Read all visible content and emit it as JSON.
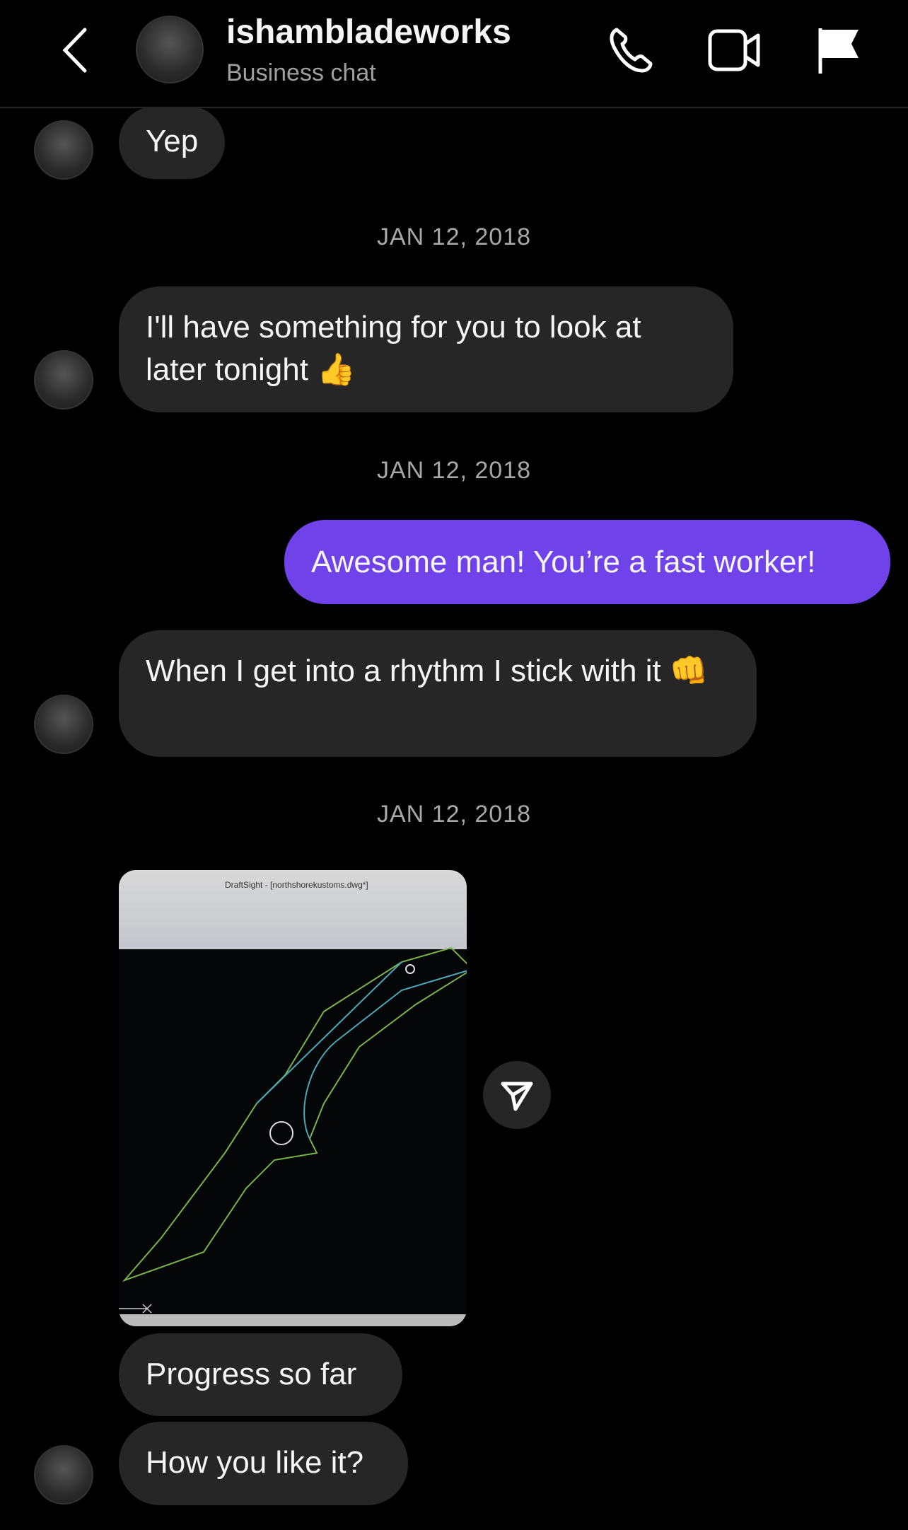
{
  "header": {
    "title": "ishambladeworks",
    "subtitle": "Business chat",
    "icons": [
      "back-chevron-icon",
      "phone-icon",
      "video-camera-icon",
      "flag-icon"
    ]
  },
  "messages": [
    {
      "from": "them",
      "text": "Yep"
    },
    {
      "date": "JAN 12, 2018"
    },
    {
      "from": "them",
      "text": "I'll have something for you to look at later tonight 👍"
    },
    {
      "date": "JAN 12, 2018"
    },
    {
      "from": "me",
      "text": "Awesome man! You’re a fast worker!"
    },
    {
      "from": "them",
      "text": "When I get into a rhythm I stick with it 👊"
    },
    {
      "date": "JAN 12, 2018"
    },
    {
      "from": "them",
      "type": "image",
      "image_text": "DraftSight - [northshorekustoms.dwg*]"
    },
    {
      "from": "them",
      "text": "Progress so far"
    },
    {
      "from": "them",
      "text": "How you like it?"
    }
  ],
  "colors": {
    "my_bubble": "#6f43e9",
    "their_bubble": "#262626",
    "background": "#000000"
  }
}
